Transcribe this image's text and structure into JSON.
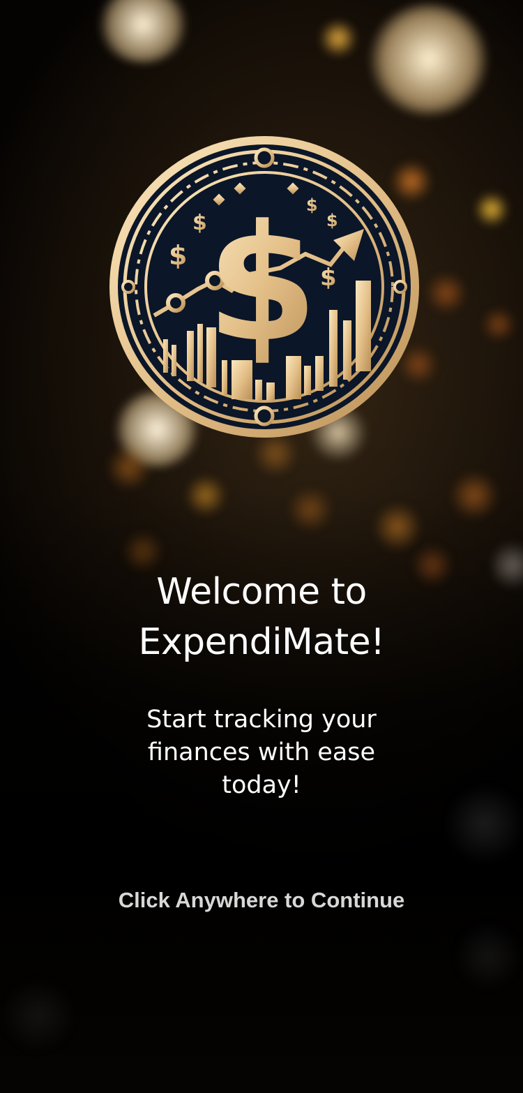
{
  "app": {
    "logo_icon": "gold-dollar-growth-coin-icon",
    "accent_gold": "#e8c98e",
    "coin_navy": "#0b1628"
  },
  "welcome": {
    "line1": "Welcome to",
    "line2": "ExpendiMate!"
  },
  "tagline": {
    "line1": "Start tracking your",
    "line2": "finances with ease",
    "line3": "today!"
  },
  "cta": {
    "label": "Click Anywhere to Continue"
  }
}
